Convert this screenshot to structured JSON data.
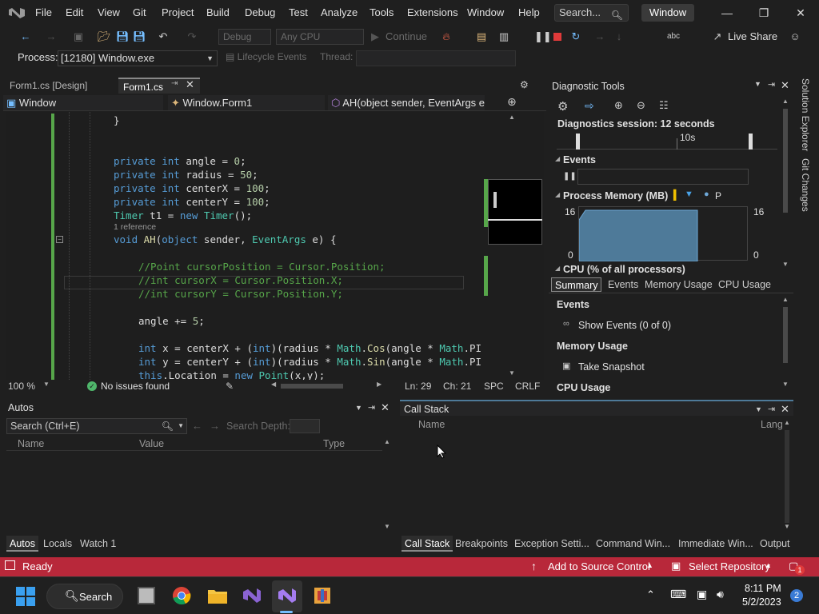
{
  "menubar": {
    "items": [
      "File",
      "Edit",
      "View",
      "Git",
      "Project",
      "Build",
      "Debug",
      "Test",
      "Analyze",
      "Tools",
      "Extensions",
      "Window",
      "Help"
    ],
    "search_placeholder": "Search...",
    "window_title": "Window"
  },
  "toolbar": {
    "config": "Debug",
    "platform": "Any CPU",
    "continue": "Continue",
    "live_share": "Live Share"
  },
  "debugbar": {
    "process_label": "Process:",
    "process_value": "[12180] Window.exe",
    "lifecycle": "Lifecycle Events",
    "thread_label": "Thread:"
  },
  "tabs": {
    "design": "Form1.cs [Design]",
    "code": "Form1.cs"
  },
  "nav": {
    "project": "Window",
    "class": "Window.Form1",
    "member": "AH(object sender, EventArgs e)"
  },
  "editor_status": {
    "zoom": "100 %",
    "issues": "No issues found",
    "line": "Ln: 29",
    "col": "Ch: 21",
    "spc": "SPC",
    "crlf": "CRLF"
  },
  "code": {
    "brace": "}",
    "ref": "1 reference"
  },
  "diagnostics": {
    "title": "Diagnostic Tools",
    "session": "Diagnostics session: 12 seconds",
    "timeline_mark": "10s",
    "events_hdr": "Events",
    "memory_hdr": "Process Memory (MB)",
    "mem_max": "16",
    "mem_min": "0",
    "mem_legend": "P",
    "cpu_hdr": "CPU (% of all processors)",
    "tabs": [
      "Summary",
      "Events",
      "Memory Usage",
      "CPU Usage"
    ],
    "section_events": "Events",
    "show_events": "Show Events (0 of 0)",
    "section_memory": "Memory Usage",
    "take_snapshot": "Take Snapshot",
    "section_cpu": "CPU Usage"
  },
  "autos": {
    "title": "Autos",
    "search_placeholder": "Search (Ctrl+E)",
    "search_depth": "Search Depth:",
    "col_name": "Name",
    "col_value": "Value",
    "col_type": "Type",
    "tabs": [
      "Autos",
      "Locals",
      "Watch 1"
    ]
  },
  "callstack": {
    "title": "Call Stack",
    "col_name": "Name",
    "col_lang": "Lang",
    "tabs": [
      "Call Stack",
      "Breakpoints",
      "Exception Setti...",
      "Command Win...",
      "Immediate Win...",
      "Output"
    ]
  },
  "rightrail": {
    "solution": "Solution Explorer",
    "git": "Git Changes"
  },
  "statusbar": {
    "ready": "Ready",
    "source_control": "Add to Source Control",
    "repo": "Select Repository",
    "notif": "1"
  },
  "taskbar": {
    "search": "Search",
    "time": "8:11 PM",
    "date": "5/2/2023",
    "badge": "2"
  },
  "colors": {
    "statusbar": "#b8283a",
    "accent": "#57a64a"
  }
}
